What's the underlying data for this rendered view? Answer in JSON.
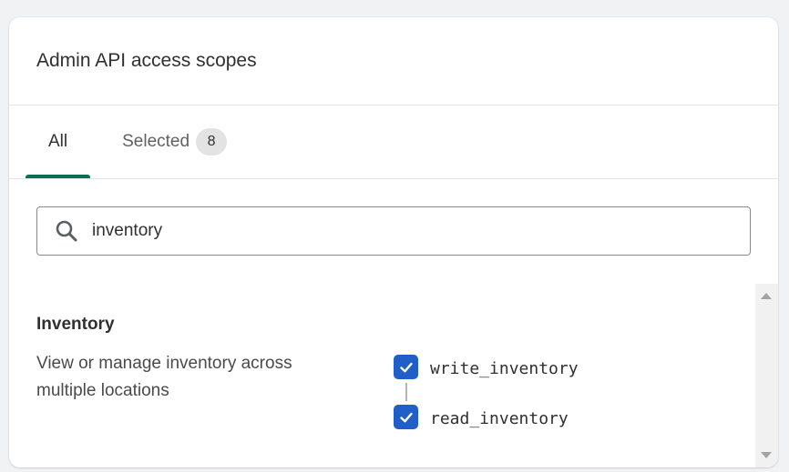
{
  "card": {
    "title": "Admin API access scopes"
  },
  "tabs": [
    {
      "label": "All",
      "active": true
    },
    {
      "label": "Selected",
      "count": "8",
      "active": false
    }
  ],
  "search": {
    "value": "inventory",
    "placeholder": "Search",
    "icon": "search-icon"
  },
  "section": {
    "title": "Inventory",
    "description": "View or manage inventory across multiple locations",
    "scopes": [
      {
        "label": "write_inventory",
        "checked": true
      },
      {
        "label": "read_inventory",
        "checked": true
      }
    ]
  },
  "colors": {
    "accent_tab": "#0a6e50",
    "checkbox": "#1f5fc7",
    "badge_bg": "#e3e3e3"
  }
}
